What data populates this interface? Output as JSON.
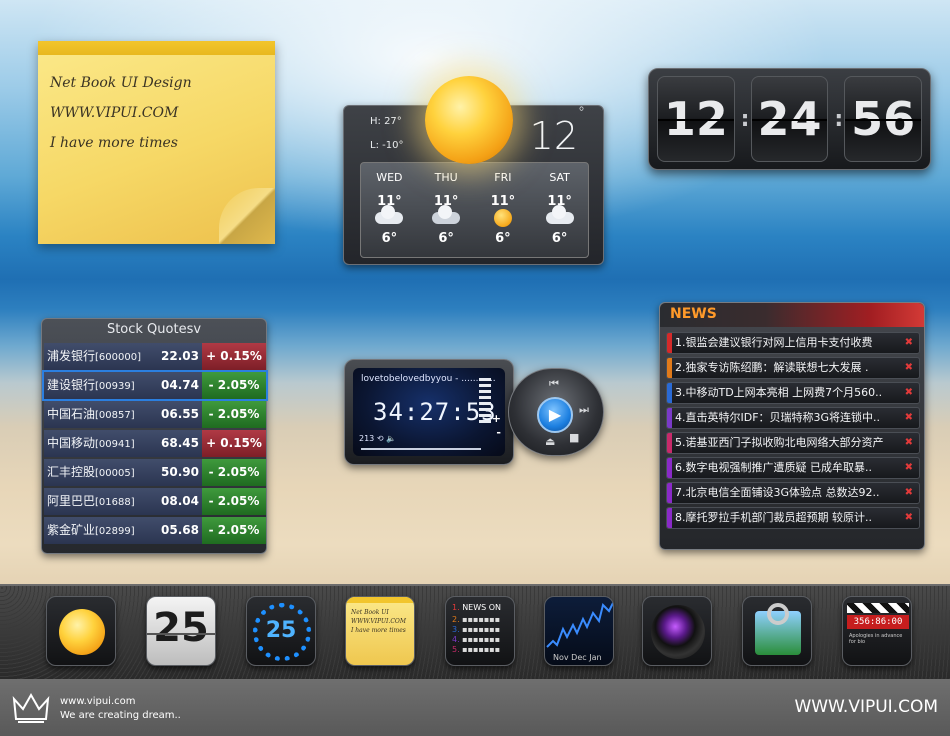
{
  "sticky_note": {
    "lines": [
      "Net Book UI Design",
      "WWW.VIPUI.COM",
      "I have more times"
    ]
  },
  "weather": {
    "high": "H: 27°",
    "low": "L: -10°",
    "current_temp": "12",
    "degree_symbol": "°",
    "forecast": [
      {
        "day": "WED",
        "hi": "11°",
        "icon": "cloudy-icon",
        "lo": "6°"
      },
      {
        "day": "THU",
        "hi": "11°",
        "icon": "rain-icon",
        "lo": "6°"
      },
      {
        "day": "FRI",
        "hi": "11°",
        "icon": "sun-icon",
        "lo": "6°"
      },
      {
        "day": "SAT",
        "hi": "11°",
        "icon": "cloudy-icon",
        "lo": "6°"
      }
    ]
  },
  "clock": {
    "hours": "12",
    "minutes": "24",
    "seconds": "56"
  },
  "stocks": {
    "title": "Stock Quotesv",
    "rows": [
      {
        "name": "浦发银行",
        "code": "[600000]",
        "price": "22.03",
        "change": "+ 0.15%",
        "dir": "up"
      },
      {
        "name": "建设银行",
        "code": "[00939]",
        "price": "04.74",
        "change": "- 2.05%",
        "dir": "down"
      },
      {
        "name": "中国石油",
        "code": "[00857]",
        "price": "06.55",
        "change": "- 2.05%",
        "dir": "down"
      },
      {
        "name": "中国移动",
        "code": "[00941]",
        "price": "68.45",
        "change": "+ 0.15%",
        "dir": "up"
      },
      {
        "name": "汇丰控股",
        "code": "[00005]",
        "price": "50.90",
        "change": "- 2.05%",
        "dir": "down"
      },
      {
        "name": "阿里巴巴",
        "code": "[01688]",
        "price": "08.04",
        "change": "- 2.05%",
        "dir": "down"
      },
      {
        "name": "紫金矿业",
        "code": "[02899]",
        "price": "05.68",
        "change": "- 2.05%",
        "dir": "down"
      }
    ]
  },
  "player": {
    "song": "lovetobelovedbyyou - ............",
    "time": "34:27:53",
    "volume": "213",
    "plus": "+",
    "minus": "-"
  },
  "news": {
    "title": "NEWS",
    "items": [
      {
        "text": "1.银监会建议银行对网上信用卡支付收费",
        "color": "#d42a2a"
      },
      {
        "text": "2.独家专访陈绍鹏：解读联想七大发展 .",
        "color": "#e07a1a"
      },
      {
        "text": "3.中移动TD上网本亮相 上网费7个月560..",
        "color": "#2a6ad4"
      },
      {
        "text": "4.直击英特尔IDF：贝瑞特称3G将连锁中..",
        "color": "#7a3ac8"
      },
      {
        "text": "5.诺基亚西门子拟收购北电网络大部分资产",
        "color": "#c82a6a"
      },
      {
        "text": "6.数字电视强制推广遭质疑 已成牟取暴..",
        "color": "#8a2ac8"
      },
      {
        "text": "7.北京电信全面铺设3G体验点 总数达92..",
        "color": "#8a2ac8"
      },
      {
        "text": "8.摩托罗拉手机部门裁员超预期 较原计..",
        "color": "#8a2ac8"
      }
    ]
  },
  "dock": {
    "calendar_day": "25",
    "timer_value": "25",
    "note_lines": [
      "Net Book UI",
      "WWW.VIPUI.COM",
      "I have more times"
    ],
    "news_label": "NEWS ON",
    "chart_months": [
      "Nov",
      "Dec",
      "Jan"
    ],
    "clapper_text": "356:86:00",
    "clapper_sub": "Apologies in advance for bio"
  },
  "footer": {
    "url": "www.vipui.com",
    "slogan": "We are creating dream..",
    "brand": "WWW.VIPUI.COM"
  }
}
